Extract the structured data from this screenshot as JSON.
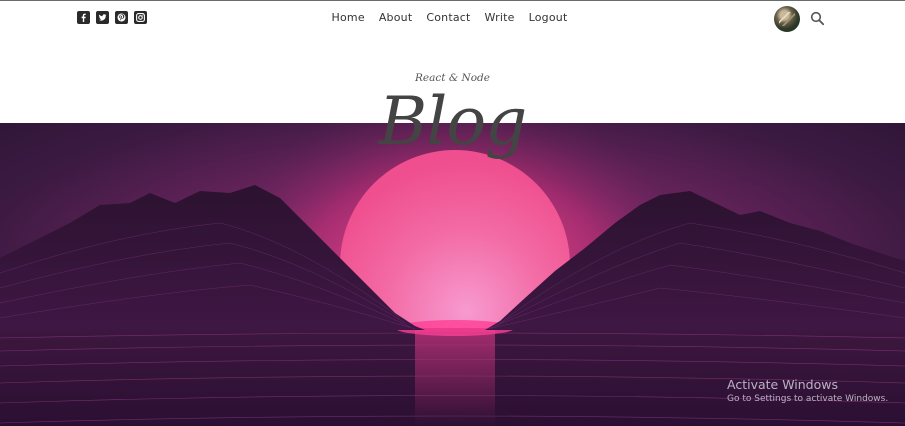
{
  "social": {
    "items": [
      {
        "icon": "facebook-square-icon"
      },
      {
        "icon": "twitter-square-icon"
      },
      {
        "icon": "pinterest-square-icon"
      },
      {
        "icon": "instagram-square-icon"
      }
    ]
  },
  "nav": {
    "items": [
      {
        "label": "Home"
      },
      {
        "label": "About"
      },
      {
        "label": "Contact"
      },
      {
        "label": "Write"
      },
      {
        "label": "Logout"
      }
    ]
  },
  "header": {
    "subtitle": "React & Node",
    "title": "Blog"
  },
  "icons": {
    "avatar": "user-avatar",
    "search": "search-icon"
  },
  "watermark": {
    "line1": "Activate Windows",
    "line2": "Go to Settings to activate Windows."
  },
  "colors": {
    "sun": "#f06aa0",
    "sky": "#3a1a3f",
    "text": "#333333"
  }
}
